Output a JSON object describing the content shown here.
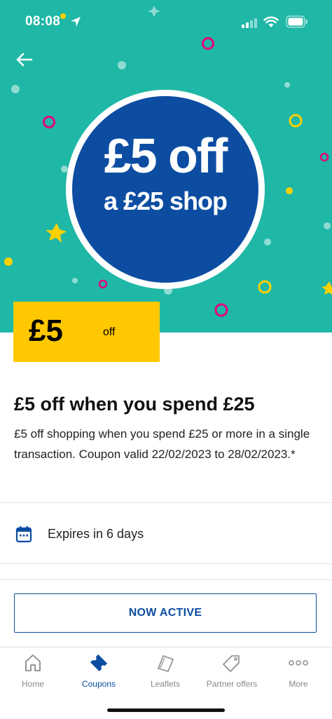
{
  "status_bar": {
    "time": "08:08"
  },
  "hero": {
    "line1": "£5 off",
    "line2": "a £25 shop",
    "brand_blue": "#0c4da2",
    "bg_teal": "#1fb7a6"
  },
  "badge": {
    "amount": "£5",
    "suffix": "off",
    "color": "#ffc800"
  },
  "offer": {
    "title": "£5 off when you spend £25",
    "description": "£5 off shopping when you spend £25 or more in a single transaction. Coupon valid 22/02/2023 to 28/02/2023.*",
    "expiry": "Expires in 6 days"
  },
  "action": {
    "label": "NOW ACTIVE"
  },
  "tabs": [
    {
      "label": "Home",
      "icon": "home-icon"
    },
    {
      "label": "Coupons",
      "icon": "coupon-ticket-icon",
      "active": true
    },
    {
      "label": "Leaflets",
      "icon": "leaflet-icon"
    },
    {
      "label": "Partner offers",
      "icon": "tag-icon"
    },
    {
      "label": "More",
      "icon": "more-dots-icon"
    }
  ]
}
